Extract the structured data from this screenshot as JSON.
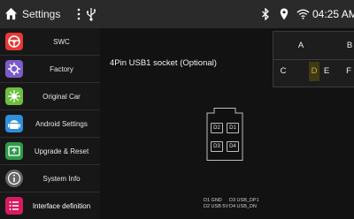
{
  "statusbar": {
    "title": "Settings",
    "time": "04:25 AM",
    "icons": [
      "home-icon",
      "more-vert-icon",
      "usb-icon",
      "bluetooth-icon",
      "location-icon",
      "wifi-icon"
    ]
  },
  "sidebar": {
    "items": [
      {
        "label": "SWC",
        "icon": "steering-wheel-icon",
        "color": "#e53935"
      },
      {
        "label": "Factory",
        "icon": "factory-icon",
        "color": "#7b5cc9"
      },
      {
        "label": "Original Car",
        "icon": "original-car-icon",
        "color": "#6fbf3f"
      },
      {
        "label": "Android Settings",
        "icon": "android-icon",
        "color": "#2f8fd8"
      },
      {
        "label": "Upgrade & Reset",
        "icon": "upgrade-icon",
        "color": "#2e9a4a"
      },
      {
        "label": "System Info",
        "icon": "info-icon",
        "color": "#666666"
      },
      {
        "label": "Interface definition",
        "icon": "list-icon",
        "color": "#d81b60",
        "selected": true
      }
    ]
  },
  "main": {
    "heading": "4Pin USB1 socket (Optional)",
    "letters_row1": [
      "A",
      "B"
    ],
    "letters_row2": [
      "C",
      "D",
      "E",
      "F"
    ],
    "selected_letter": "D",
    "pins": [
      "D2",
      "D1",
      "D3",
      "D4"
    ],
    "legend_left": [
      "D1 GND",
      "D2 USB 5V"
    ],
    "legend_right": [
      "D3 USB_DP1",
      "D4 USB_DN"
    ]
  }
}
